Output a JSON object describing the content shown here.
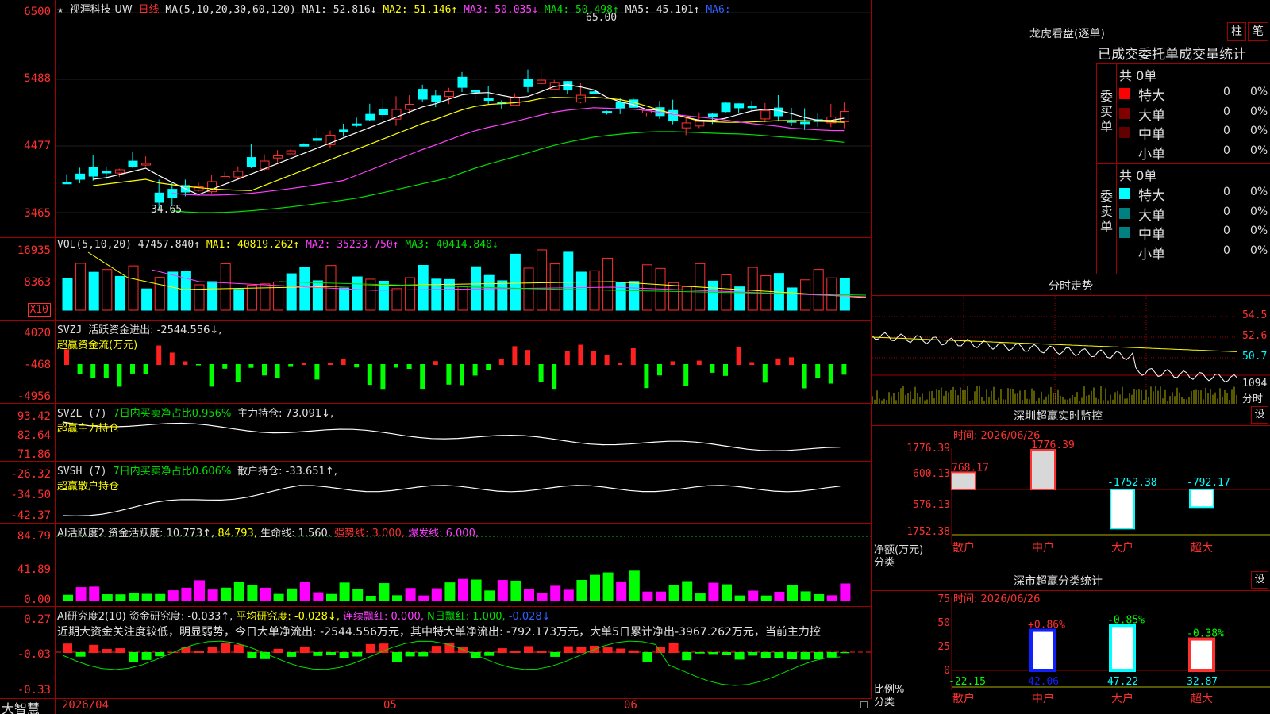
{
  "app": {
    "logo": "大智慧"
  },
  "main_chart": {
    "star": "★",
    "stock": "视涯科技-UW",
    "period": "日线",
    "ma_label": "MA(5,10,20,30,60,120)",
    "ma1": "MA1: 52.816↓",
    "ma2": "MA2: 51.146↑",
    "ma3": "MA3: 50.035↓",
    "ma4": "MA4: 50.498↑",
    "ma5": "MA5: 45.101↑",
    "ma6": "MA6:",
    "y_ticks": [
      "6500",
      "5488",
      "4477",
      "3465"
    ],
    "high_label": "65.00",
    "low_label": "34.65"
  },
  "vol_panel": {
    "label": "VOL(5,10,20)",
    "value": "47457.840↑",
    "ma1": "MA1: 40819.262↑",
    "ma2": "MA2: 35233.750↑",
    "ma3": "MA3: 40414.840↓",
    "y_ticks": [
      "16935",
      "8363"
    ],
    "unit": "X10"
  },
  "svzj_panel": {
    "label": "SVZJ",
    "text": "活跃资金进出: -2544.556↓,",
    "sub": "超赢资金流(万元)",
    "y_ticks": [
      "4020",
      "-468",
      "-4956"
    ]
  },
  "svzl_panel": {
    "label": "SVZL (7)",
    "text_g": "7日内买卖净占比0.956%",
    "text_w": "主力持仓: 73.091↓,",
    "sub": "超赢主力持仓",
    "y_ticks": [
      "93.42",
      "82.64",
      "71.86"
    ]
  },
  "svsh_panel": {
    "label": "SVSH (7)",
    "text_g": "7日内买卖净占比0.606%",
    "text_w": "散户持仓: -33.651↑,",
    "sub": "超赢散户持仓",
    "y_ticks": [
      "-26.32",
      "-34.50",
      "-42.37"
    ]
  },
  "ai1_panel": {
    "label": "AI活跃度2",
    "t1": "资金活跃度: 10.773↑,",
    "t2": "84.793,",
    "t3": "生命线: 1.560,",
    "t4": "强势线: 3.000,",
    "t5": "爆发线: 6.000,",
    "y_ticks": [
      "84.79",
      "41.89",
      "0.00"
    ]
  },
  "ai2_panel": {
    "label": "AI研究度2(10)",
    "t1": "资金研究度: -0.033↑,",
    "t2": "平均研究度: -0.028↓,",
    "t3": "连续飘红: 0.000,",
    "t4": "N日飘红: 1.000,",
    "t5": "-0.028↓",
    "comment": "近期大资金关注度较低，明显弱势，今日大单净流出: -2544.556万元，其中特大单净流出: -792.173万元，大单5日累计净出-3967.262万元，当前主力控",
    "y_ticks": [
      "0.27",
      "-0.03",
      "-0.33"
    ]
  },
  "x_axis": [
    "2026/04",
    "05",
    "06"
  ],
  "longhu": {
    "title": "龙虎看盘(逐单)",
    "btn1": "柱",
    "btn2": "笔",
    "sub": "已成交委托单成交量统计",
    "buy_side": "委买单",
    "sell_side": "委卖单",
    "buy_total": "共 0单",
    "sell_total": "共 0单",
    "buy_rows": [
      {
        "label": "特大",
        "count": "0",
        "pct": "0%",
        "color": "#ff0000"
      },
      {
        "label": "大单",
        "count": "0",
        "pct": "0%",
        "color": "#800000"
      },
      {
        "label": "中单",
        "count": "0",
        "pct": "0%",
        "color": "#600000"
      },
      {
        "label": "小单",
        "count": "0",
        "pct": "0%",
        "color": ""
      }
    ],
    "sell_rows": [
      {
        "label": "特大",
        "count": "0",
        "pct": "0%",
        "color": "#00ffff"
      },
      {
        "label": "大单",
        "count": "0",
        "pct": "0%",
        "color": "#008080"
      },
      {
        "label": "中单",
        "count": "0",
        "pct": "0%",
        "color": "#008080"
      },
      {
        "label": "小单",
        "count": "0",
        "pct": "0%",
        "color": ""
      }
    ]
  },
  "intraday": {
    "title": "分时走势",
    "y_ticks": [
      "54.5",
      "52.6",
      "50.7"
    ],
    "vol_tick": "1094",
    "foot": "分时"
  },
  "sz_monitor": {
    "title": "深圳超赢实时监控",
    "btn": "设",
    "time": "时间: 2026/06/26",
    "y_ticks": [
      "1776.39",
      "600.13",
      "-576.13",
      "-1752.38"
    ],
    "ylabel1": "净额(万元)",
    "ylabel2": "分类",
    "cats": [
      "散户",
      "中户",
      "大户",
      "超大"
    ],
    "labels": [
      "768.17",
      "1776.39",
      "-1752.38",
      "-792.17"
    ],
    "chart_data": {
      "type": "bar",
      "categories": [
        "散户",
        "中户",
        "大户",
        "超大"
      ],
      "values": [
        768.17,
        1776.39,
        -1752.38,
        -792.17
      ],
      "ylim": [
        -1752.38,
        1776.39
      ]
    }
  },
  "sz_class": {
    "title": "深市超赢分类统计",
    "btn": "设",
    "time": "时间: 2026/06/26",
    "y_ticks": [
      "75",
      "50",
      "25",
      "0"
    ],
    "ylabel1": "比例%",
    "ylabel2": "分类",
    "cats": [
      "散户",
      "中户",
      "大户",
      "超大"
    ],
    "top_labels": [
      "",
      "+0.86%",
      "-0.85%",
      "-0.38%"
    ],
    "bottom_labels": [
      "-22.15",
      "42.06",
      "47.22",
      "32.87"
    ],
    "chart_data": {
      "type": "bar",
      "categories": [
        "散户",
        "中户",
        "大户",
        "超大"
      ],
      "values": [
        -22.15,
        42.06,
        47.22,
        32.87
      ],
      "ylim": [
        0,
        75
      ]
    }
  }
}
